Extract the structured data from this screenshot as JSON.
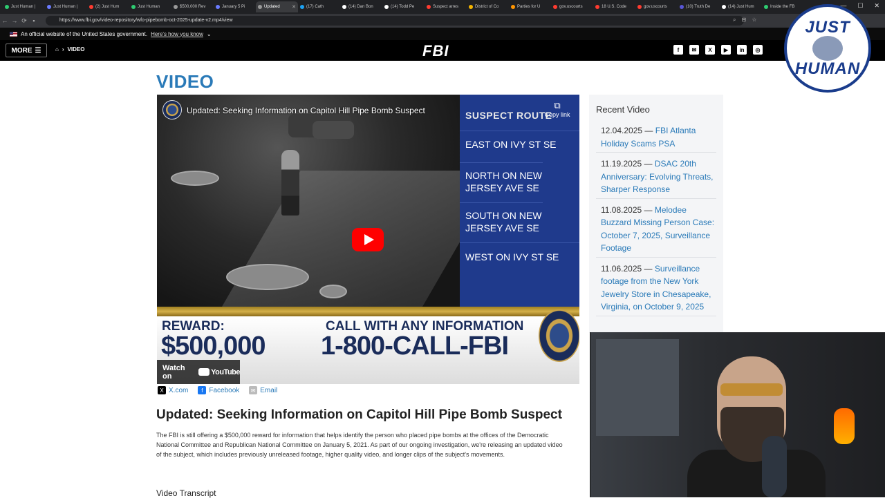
{
  "browser": {
    "tabs": [
      {
        "label": "Just Human |",
        "color": "#2ecc71"
      },
      {
        "label": "Just Human |",
        "color": "#6a7bff"
      },
      {
        "label": "(2) Just Hum",
        "color": "#ff3b30"
      },
      {
        "label": "Just Human",
        "color": "#2ecc71"
      },
      {
        "label": "$500,000 Rev",
        "color": "#999999"
      },
      {
        "label": "January 5 Pi",
        "color": "#6a7bff"
      },
      {
        "label": "Updated",
        "color": "#999999",
        "active": true
      },
      {
        "label": "(17) Cath",
        "color": "#1da1f2"
      },
      {
        "label": "(14) Dan Bon",
        "color": "#ffffff"
      },
      {
        "label": "(14) Todd Pe",
        "color": "#ffffff"
      },
      {
        "label": "Suspect arres",
        "color": "#ff3b30"
      },
      {
        "label": "District of Co",
        "color": "#f4b400"
      },
      {
        "label": "Parties for U",
        "color": "#ff9500"
      },
      {
        "label": "gov.uscourts",
        "color": "#ff3b30"
      },
      {
        "label": "18 U.S. Code",
        "color": "#ff3b30"
      },
      {
        "label": "gov.uscourts",
        "color": "#ff3b30"
      },
      {
        "label": "(10) Truth De",
        "color": "#5856d6"
      },
      {
        "label": "(14) Just Hum",
        "color": "#ffffff"
      },
      {
        "label": "Inside the FB",
        "color": "#2ecc71"
      }
    ],
    "url": "https://www.fbi.gov/video-repository/wfo-pipebomb-oct-2025-update-v2.mp4/view"
  },
  "gov_banner": {
    "text": "An official website of the United States government.",
    "link": "Here's how you know"
  },
  "nav": {
    "more": "MORE",
    "breadcrumb": "VIDEO",
    "logo": "FBI",
    "social": [
      "f",
      "✉",
      "X",
      "▶",
      "in",
      "◎"
    ]
  },
  "page": {
    "title": "VIDEO"
  },
  "video": {
    "title": "Updated: Seeking Information on Capitol Hill Pipe Bomb Suspect",
    "copy_link": "Copy link",
    "route_header": "SUSPECT ROUTE",
    "route": [
      "EAST ON IVY ST SE",
      "NORTH ON NEW JERSEY AVE SE",
      "SOUTH ON NEW JERSEY AVE SE",
      "WEST ON IVY ST SE"
    ],
    "reward_label": "REWARD:",
    "reward_amount": "$500,000",
    "call_label": "CALL WITH ANY INFORMATION",
    "call_number": "1-800-CALL-FBI",
    "watch_on": "Watch on",
    "youtube": "YouTube"
  },
  "share": {
    "x": "X.com",
    "facebook": "Facebook",
    "email": "Email"
  },
  "article": {
    "title": "Updated: Seeking Information on Capitol Hill Pipe Bomb Suspect",
    "body": "The FBI is still offering a $500,000 reward for information that helps identify the person who placed pipe bombs at the offices of the Democratic National Committee and Republican National Committee on January 5, 2021. As part of our ongoing investigation, we're releasing an updated video of the subject, which includes previously unreleased footage, higher quality video, and longer clips of the subject's movements.",
    "transcript_heading": "Video Transcript"
  },
  "sidebar": {
    "heading": "Recent Video",
    "items": [
      {
        "date": "12.04.2025",
        "title": "FBI Atlanta Holiday Scams PSA"
      },
      {
        "date": "11.19.2025",
        "title": "DSAC 20th Anniversary: Evolving Threats, Sharper Response"
      },
      {
        "date": "11.08.2025",
        "title": "Melodee Buzzard Missing Person Case: October 7, 2025, Surveillance Footage"
      },
      {
        "date": "11.06.2025",
        "title": "Surveillance footage from the New York Jewelry Store in Chesapeake, Virginia, on October 9, 2025"
      }
    ]
  },
  "overlay": {
    "badge_line1": "JUST",
    "badge_line2": "HUMAN"
  }
}
